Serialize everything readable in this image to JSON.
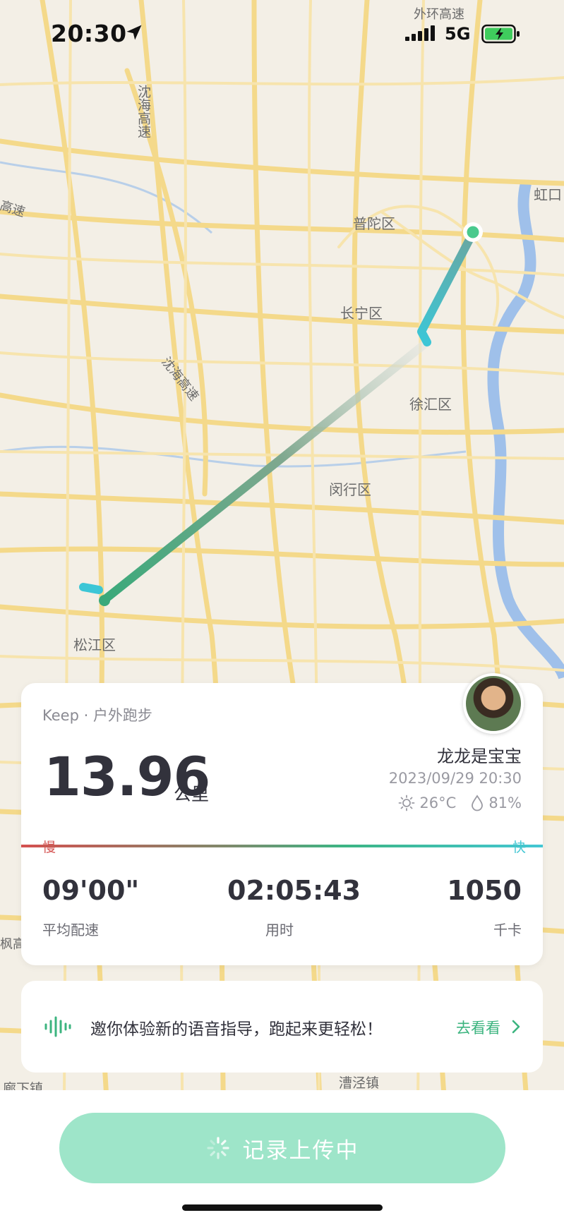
{
  "status_bar": {
    "time": "20:30",
    "network": "5G",
    "icons": [
      "location-arrow-icon",
      "signal-icon",
      "battery-charging-icon"
    ]
  },
  "map": {
    "labels": [
      "外环高速",
      "沈海高速",
      "高速",
      "普陀区",
      "长宁区",
      "徐汇区",
      "闵行区",
      "松江区",
      "沈海高速",
      "虹口",
      "漕泾镇",
      "廊下镇",
      "枫高"
    ],
    "route_colors": {
      "start": "#3cc6d6",
      "mid": "#3aa97a",
      "faded": "#cfd4cc",
      "end": "#49c98d"
    }
  },
  "card": {
    "brand": "Keep · 户外跑步",
    "distance": "13.96",
    "distance_unit": "公里",
    "username": "龙龙是宝宝",
    "datetime": "2023/09/29 20:30",
    "temperature": "26°C",
    "humidity": "81%",
    "pace_slow_label": "慢",
    "pace_fast_label": "快",
    "stats": [
      {
        "value": "09'00\"",
        "label": "平均配速"
      },
      {
        "value": "02:05:43",
        "label": "用时"
      },
      {
        "value": "1050",
        "label": "千卡"
      }
    ]
  },
  "banner": {
    "text": "邀你体验新的语音指导，跑起来更轻松！",
    "link": "去看看"
  },
  "bottom": {
    "upload_label": "记录上传中"
  },
  "colors": {
    "accent": "#3cb47f",
    "button": "#9ee5c9",
    "slow": "#d4504f",
    "fast": "#43c7d4"
  }
}
